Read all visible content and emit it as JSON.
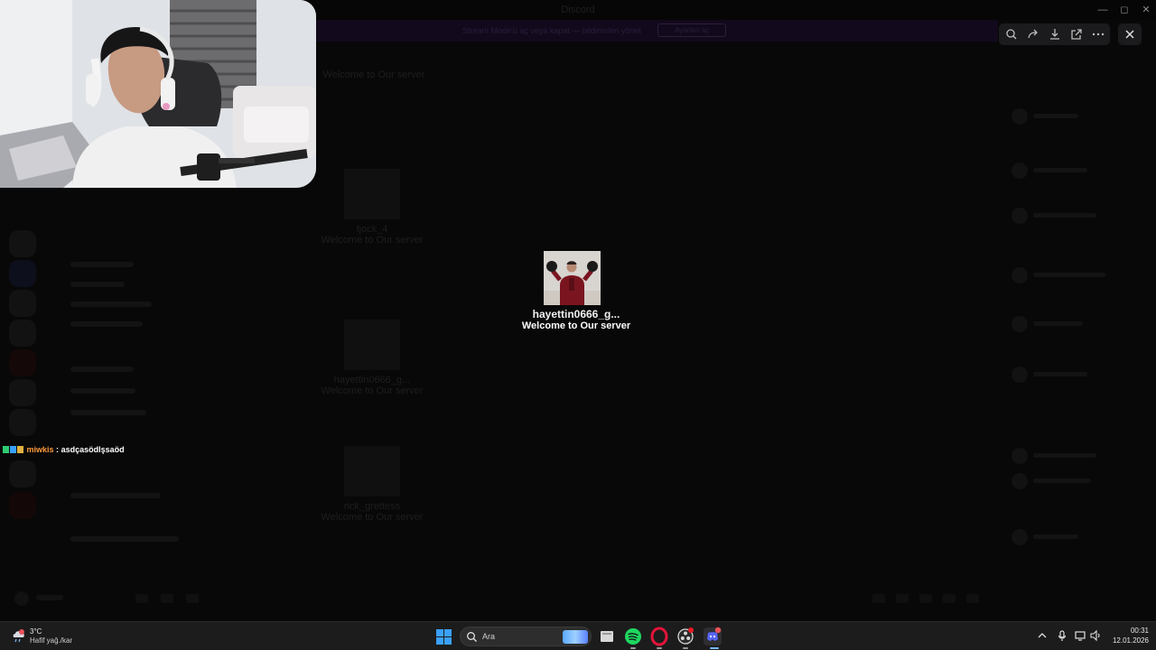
{
  "window": {
    "title": "Discord"
  },
  "notice": {
    "text": "Stream Mode'u aç veya kapat — bildirimleri yönet",
    "button": "Ayarları aç"
  },
  "viewer_tools": {
    "icons": [
      "zoom-icon",
      "share-icon",
      "download-icon",
      "open-external-icon",
      "more-icon",
      "close-icon"
    ]
  },
  "stage": {
    "center_participant": {
      "name": "hayettin0666_g...",
      "subtitle": "Welcome to Our server"
    },
    "dimmed_tiles": [
      {
        "name": "tjock_4",
        "subtitle": "Welcome to Our server"
      },
      {
        "name": "hayettin0666_g...",
        "subtitle": "Welcome to Our server"
      },
      {
        "name": "rick_grettess",
        "subtitle": "Welcome to Our server"
      }
    ],
    "top_label": "Welcome to Our server"
  },
  "chat": {
    "username": "miwkis",
    "separator": ":",
    "message": "asdçasödlşsaöd"
  },
  "taskbar": {
    "weather_temp": "3°C",
    "weather_condition": "Hafif yağ./kar",
    "search_placeholder": "Ara",
    "time": "00:31",
    "date": "12.01.2026",
    "colors": {
      "start_blue": "#3aa0ff",
      "spotify_green": "#1ed760",
      "opera_red": "#e3143a",
      "discord_blurple": "#5865f2"
    }
  }
}
